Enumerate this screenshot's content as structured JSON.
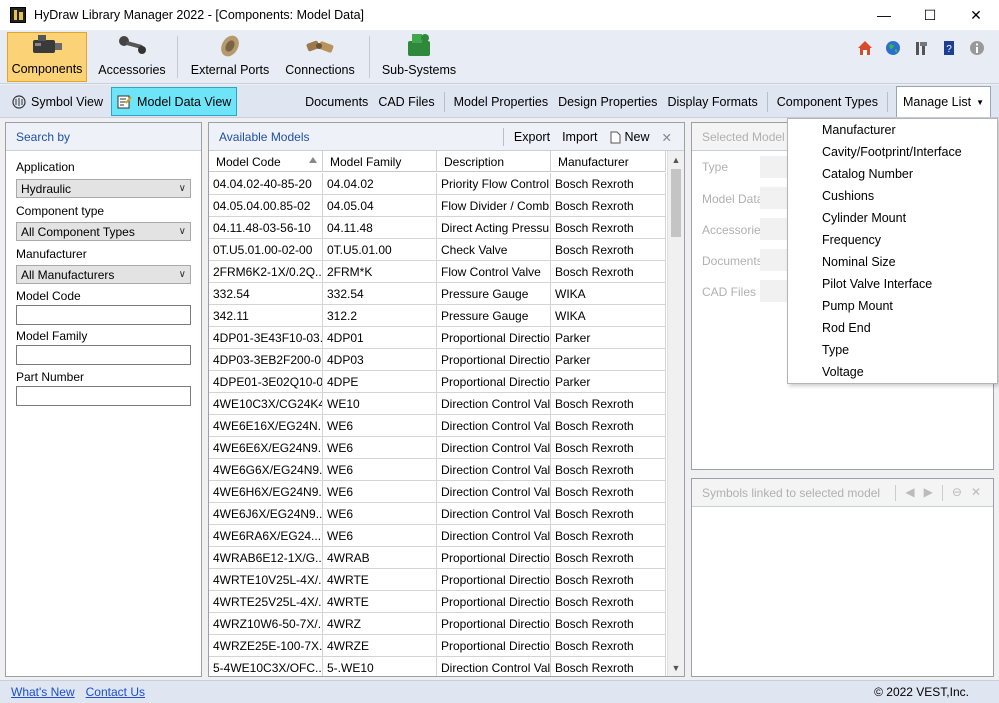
{
  "window": {
    "title": "HyDraw Library Manager 2022 - [Components: Model Data]",
    "controls": [
      "—",
      "☐",
      "✕"
    ]
  },
  "ribbon": {
    "buttons": [
      {
        "label": "Components",
        "icon": "components-icon",
        "active": true
      },
      {
        "label": "Accessories",
        "icon": "accessories-icon",
        "active": false
      },
      {
        "label": "External Ports",
        "icon": "external-ports-icon",
        "active": false
      },
      {
        "label": "Connections",
        "icon": "connections-icon",
        "active": false
      },
      {
        "label": "Sub-Systems",
        "icon": "sub-systems-icon",
        "active": false
      }
    ],
    "right_icons": [
      "home-icon",
      "globe-icon",
      "tools-icon",
      "help-book-icon",
      "info-icon"
    ]
  },
  "navbar": {
    "symbol_view": "Symbol View",
    "model_data_view": "Model Data View",
    "links": [
      "Documents",
      "CAD Files",
      "Model Properties",
      "Design Properties",
      "Display Formats",
      "Component Types"
    ],
    "manage_list": "Manage List"
  },
  "search": {
    "header": "Search by",
    "application_label": "Application",
    "application_value": "Hydraulic",
    "component_type_label": "Component type",
    "component_type_value": "All Component Types",
    "manufacturer_label": "Manufacturer",
    "manufacturer_value": "All Manufacturers",
    "model_code_label": "Model Code",
    "model_family_label": "Model Family",
    "part_number_label": "Part Number"
  },
  "models": {
    "header": "Available Models",
    "export": "Export",
    "import": "Import",
    "new": "New",
    "close": "✕",
    "columns": [
      "Model Code",
      "Model Family",
      "Description",
      "Manufacturer"
    ],
    "rows": [
      [
        "04.04.02-40-85-20",
        "04.04.02",
        "Priority Flow Control ...",
        "Bosch Rexroth"
      ],
      [
        "04.05.04.00.85-02",
        "04.05.04",
        "Flow Divider / Comb...",
        "Bosch Rexroth"
      ],
      [
        "04.11.48-03-56-10",
        "04.11.48",
        "Direct Acting Pressu...",
        "Bosch Rexroth"
      ],
      [
        "0T.U5.01.00-02-00",
        "0T.U5.01.00",
        "Check Valve",
        "Bosch Rexroth"
      ],
      [
        "2FRM6K2-1X/0.2Q...",
        "2FRM*K",
        "Flow Control Valve",
        "Bosch Rexroth"
      ],
      [
        "332.54",
        "332.54",
        "Pressure Gauge",
        "WIKA"
      ],
      [
        "342.11",
        "312.2",
        "Pressure Gauge",
        "WIKA"
      ],
      [
        "4DP01-3E43F10-03...",
        "4DP01",
        "Proportional Directio...",
        "Parker"
      ],
      [
        "4DP03-3EB2F200-0...",
        "4DP03",
        "Proportional Directio...",
        "Parker"
      ],
      [
        "4DPE01-3E02Q10-0...",
        "4DPE",
        "Proportional Directio...",
        "Parker"
      ],
      [
        "4WE10C3X/CG24K4",
        "WE10",
        "Direction Control Val...",
        "Bosch Rexroth"
      ],
      [
        "4WE6E16X/EG24N...",
        "WE6",
        "Direction Control Val...",
        "Bosch Rexroth"
      ],
      [
        "4WE6E6X/EG24N9...",
        "WE6",
        "Direction Control Val...",
        "Bosch Rexroth"
      ],
      [
        "4WE6G6X/EG24N9...",
        "WE6",
        "Direction Control Val...",
        "Bosch Rexroth"
      ],
      [
        "4WE6H6X/EG24N9...",
        "WE6",
        "Direction Control Val...",
        "Bosch Rexroth"
      ],
      [
        "4WE6J6X/EG24N9...",
        "WE6",
        "Direction Control Val...",
        "Bosch Rexroth"
      ],
      [
        "4WE6RA6X/EG24...",
        "WE6",
        "Direction Control Val...",
        "Bosch Rexroth"
      ],
      [
        "4WRAB6E12-1X/G...",
        "4WRAB",
        "Proportional Directio...",
        "Bosch Rexroth"
      ],
      [
        "4WRTE10V25L-4X/...",
        "4WRTE",
        "Proportional Directio...",
        "Bosch Rexroth"
      ],
      [
        "4WRTE25V25L-4X/...",
        "4WRTE",
        "Proportional Directio...",
        "Bosch Rexroth"
      ],
      [
        "4WRZ10W6-50-7X/...",
        "4WRZ",
        "Proportional Directio...",
        "Bosch Rexroth"
      ],
      [
        "4WRZE25E-100-7X...",
        "4WRZE",
        "Proportional Directio...",
        "Bosch Rexroth"
      ],
      [
        "5-4WE10C3X/OFC...",
        "5-.WE10",
        "Direction Control Val...",
        "Bosch Rexroth"
      ]
    ]
  },
  "selected": {
    "header": "Selected Model pr",
    "labels": [
      "Type",
      "Model Data",
      "Accessories",
      "Documents",
      "CAD Files"
    ]
  },
  "symbols": {
    "header": "Symbols linked to selected model"
  },
  "manage_menu": {
    "items": [
      "Manufacturer",
      "Cavity/Footprint/Interface",
      "Catalog Number",
      "Cushions",
      "Cylinder Mount",
      "Frequency",
      "Nominal Size",
      "Pilot Valve Interface",
      "Pump Mount",
      "Rod End",
      "Type",
      "Voltage"
    ]
  },
  "status": {
    "whats_new": "What's New",
    "contact_us": "Contact Us",
    "copyright": "© 2022 VEST,Inc."
  },
  "colors": {
    "active_ribbon": "#fbd275",
    "active_view": "#6ee4f8",
    "link": "#1a4fd0"
  }
}
